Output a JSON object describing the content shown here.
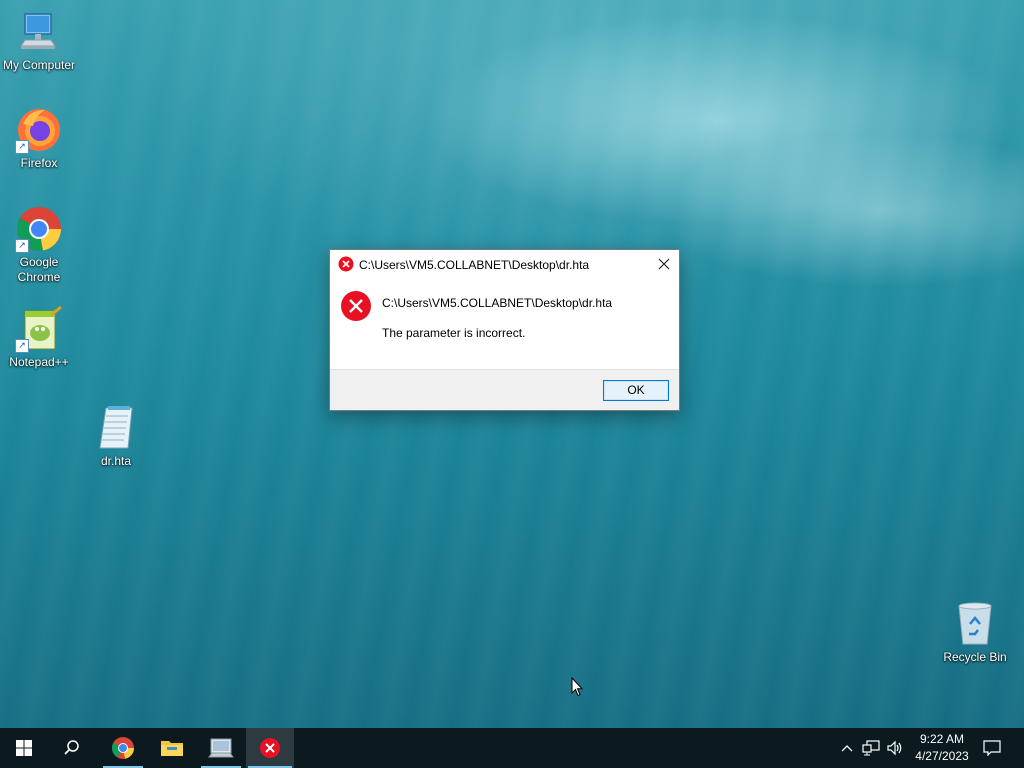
{
  "desktop": {
    "icons": [
      {
        "label": "My Computer",
        "icon": "computer-icon"
      },
      {
        "label": "Firefox",
        "icon": "firefox-icon",
        "shortcut": true
      },
      {
        "label": "Google Chrome",
        "icon": "chrome-icon",
        "shortcut": true
      },
      {
        "label": "Notepad++",
        "icon": "notepadpp-icon",
        "shortcut": true
      },
      {
        "label": "dr.hta",
        "icon": "hta-file-icon"
      },
      {
        "label": "Recycle Bin",
        "icon": "recycle-bin-icon"
      }
    ]
  },
  "dialog": {
    "title": "C:\\Users\\VM5.COLLABNET\\Desktop\\dr.hta",
    "path": "C:\\Users\\VM5.COLLABNET\\Desktop\\dr.hta",
    "message": "The parameter is incorrect.",
    "ok_label": "OK",
    "error_color": "#e81123"
  },
  "taskbar": {
    "buttons": [
      "start-icon",
      "search-icon",
      "chrome-icon",
      "file-explorer-icon",
      "mshta-icon",
      "error-icon"
    ],
    "tray_icons": [
      "chevron-up-icon",
      "network-icon",
      "volume-icon",
      "notification-icon"
    ],
    "time": "9:22 AM",
    "date": "4/27/2023"
  }
}
